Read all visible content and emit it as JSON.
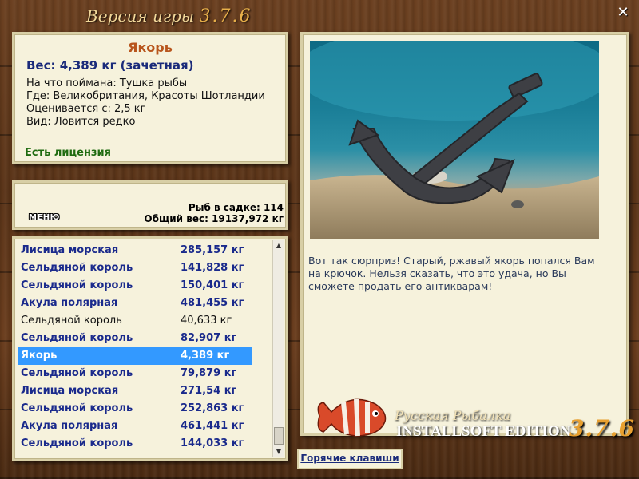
{
  "header": {
    "title": "Версия игры",
    "version": "3.7.6",
    "close_glyph": "✕"
  },
  "info": {
    "fish_name": "Якорь",
    "weight_line": "Вес: 4,389 кг (зачетная)",
    "caught_on": "На что поймана: Тушка рыбы",
    "where": "Где: Великобритания, Красоты Шотландии",
    "valued_from": "Оценивается с: 2,5 кг",
    "kind": "Вид: Ловится редко",
    "license": "Есть лицензия"
  },
  "stats": {
    "menu_label": "МЕНЮ",
    "fish_in_cage": "Рыб в садке: 114",
    "total_weight": "Общий вес: 19137,972 кг"
  },
  "catch_list": [
    {
      "name": "Лисица морская",
      "weight": "285,157 кг",
      "style": "bold"
    },
    {
      "name": "Сельдяной король",
      "weight": "141,828 кг",
      "style": "bold"
    },
    {
      "name": "Сельдяной король",
      "weight": "150,401 кг",
      "style": "bold"
    },
    {
      "name": "Акула полярная",
      "weight": "481,455 кг",
      "style": "bold"
    },
    {
      "name": "Сельдяной король",
      "weight": "40,633 кг",
      "style": "plain"
    },
    {
      "name": "Сельдяной король",
      "weight": "82,907 кг",
      "style": "bold"
    },
    {
      "name": "Якорь",
      "weight": "4,389 кг",
      "style": "selected"
    },
    {
      "name": "Сельдяной король",
      "weight": "79,879 кг",
      "style": "bold"
    },
    {
      "name": "Лисица морская",
      "weight": "271,54 кг",
      "style": "bold"
    },
    {
      "name": "Сельдяной король",
      "weight": "252,863 кг",
      "style": "bold"
    },
    {
      "name": "Акула полярная",
      "weight": "461,441 кг",
      "style": "bold"
    },
    {
      "name": "Сельдяной король",
      "weight": "144,033 кг",
      "style": "bold"
    }
  ],
  "description": "Вот так сюрприз! Старый, ржавый якорь попался Вам на крючок. Нельзя сказать, что это удача, но Вы сможете продать его антикварам!",
  "hotkeys_label": "Горячие клавиши",
  "branding": {
    "line1": "Русская Рыбалка",
    "line2": "INSTALLSOFT EDITION",
    "version": "3.7.6"
  },
  "colors": {
    "selection": "#3399ff",
    "fish_name": "#b8551c",
    "list_text": "#1a2a8c",
    "license": "#1f6b10"
  }
}
